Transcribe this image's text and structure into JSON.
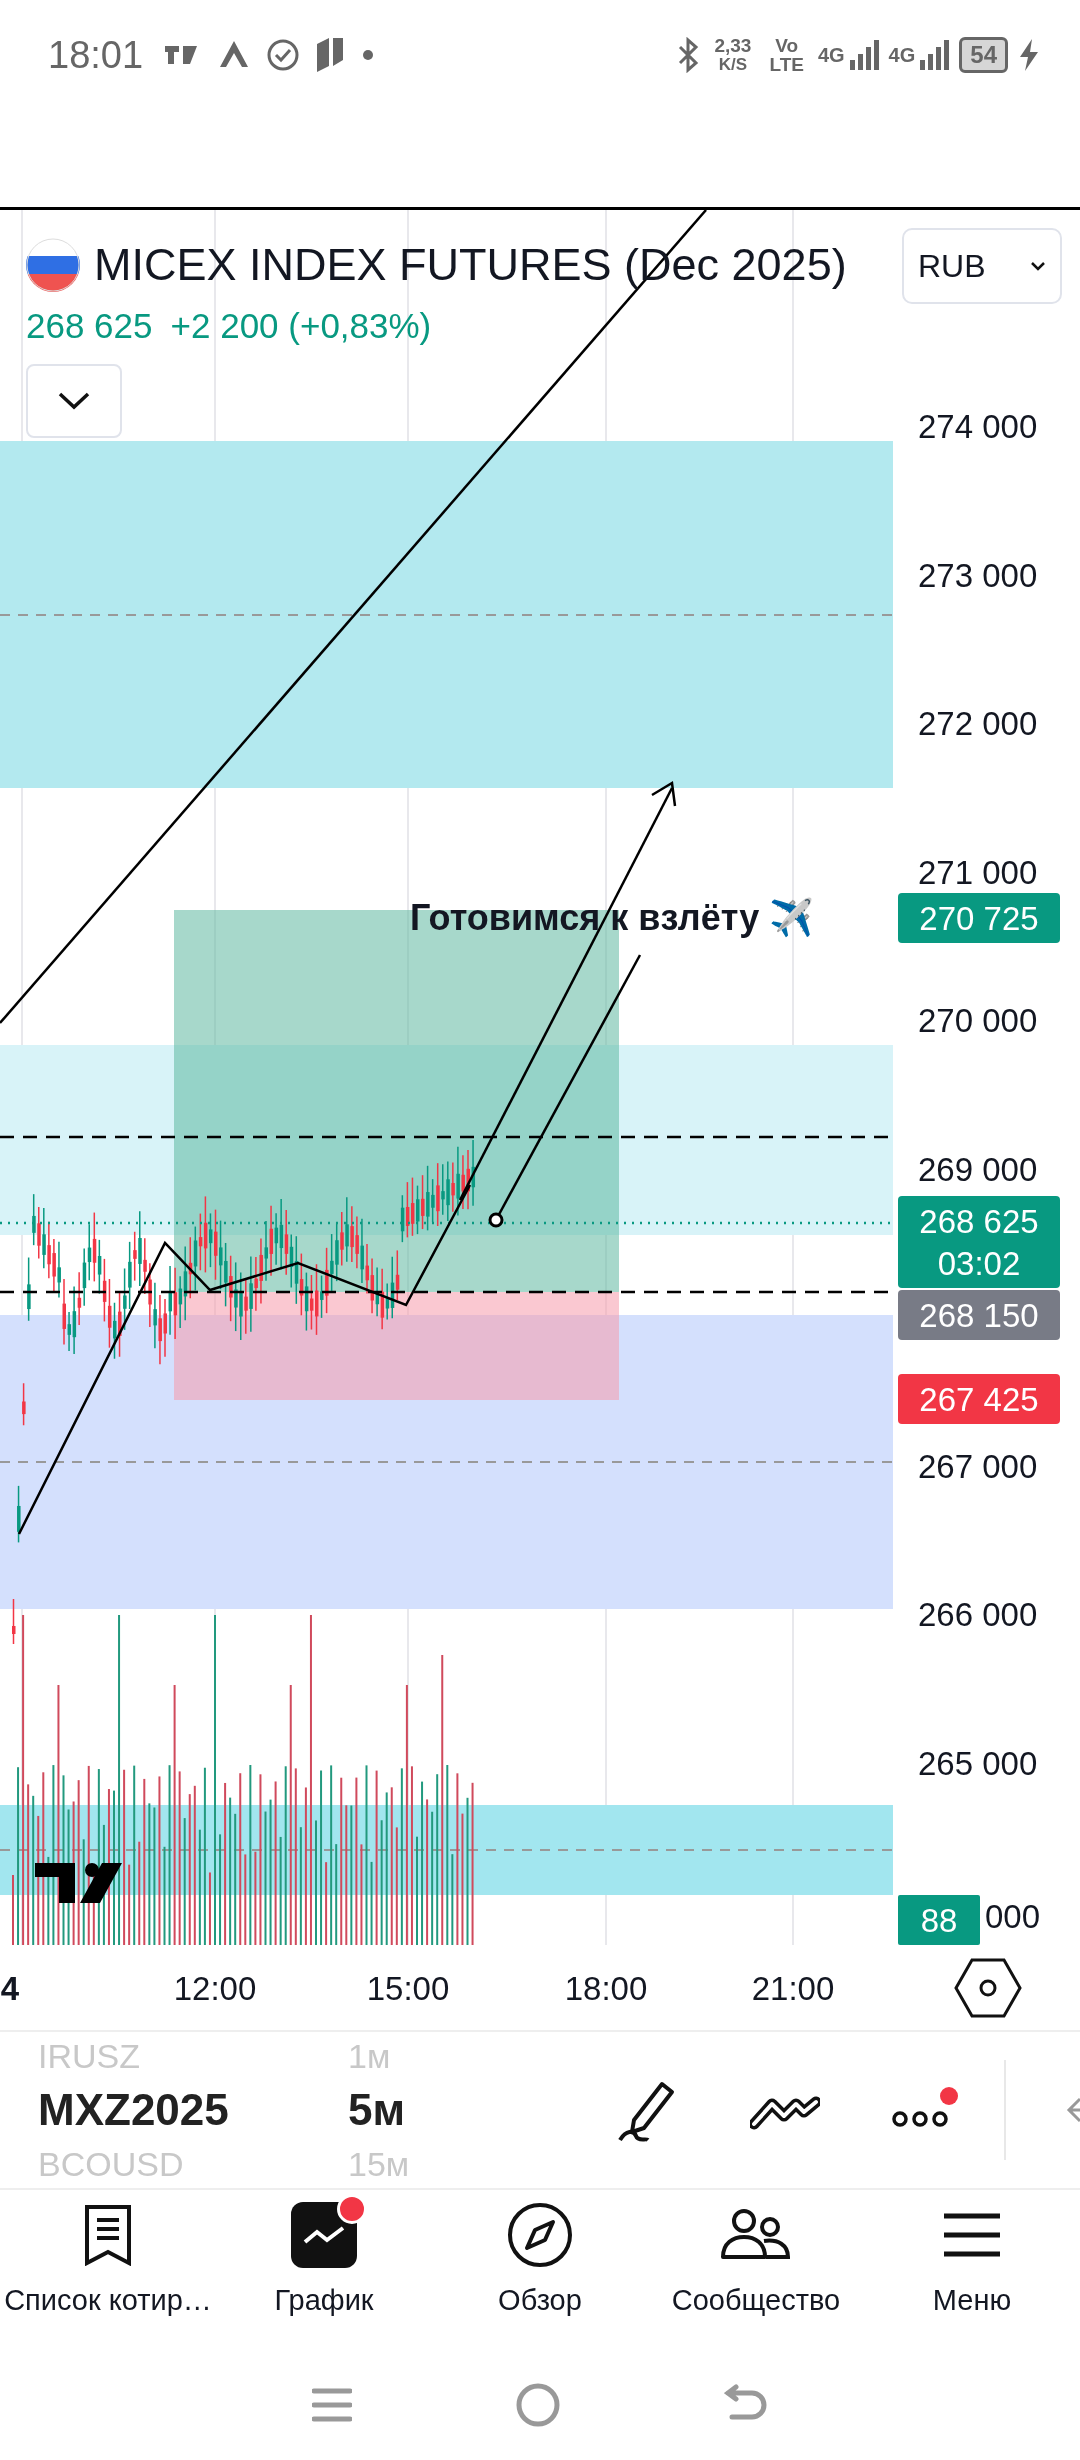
{
  "status_bar": {
    "time": "18:01",
    "speed_value": "2,33",
    "speed_unit": "K/S",
    "volte": [
      "Vo",
      "LTE"
    ],
    "networks": [
      "4G",
      "4G"
    ],
    "battery": "54"
  },
  "header": {
    "title": "MICEX INDEX FUTURES (Dec 2025)",
    "price": "268 625",
    "change": "+2 200 (+0,83%)",
    "currency": "RUB"
  },
  "chart": {
    "price_axis": [
      "274 000",
      "273 000",
      "272 000",
      "271 000",
      "270 000",
      "269 000",
      "267 000",
      "266 000",
      "265 000",
      "000"
    ],
    "time_axis": [
      "4",
      "12:00",
      "15:00",
      "18:00",
      "21:00"
    ],
    "price_tags": [
      {
        "lines": [
          "270 725"
        ],
        "color": "#089981"
      },
      {
        "lines": [
          "268 625",
          "03:02"
        ],
        "color": "#089981"
      },
      {
        "lines": [
          "268 150"
        ],
        "color": "#787b86"
      },
      {
        "lines": [
          "267 425"
        ],
        "color": "#f23645"
      }
    ],
    "annotation": "Готовимся к взлёту ✈️",
    "volume_tag": "88"
  },
  "symbols": [
    {
      "symbol": "IRUSZ",
      "interval": "1м",
      "selected": false
    },
    {
      "symbol": "MXZ2025",
      "interval": "5м",
      "selected": true
    },
    {
      "symbol": "BCOUSD",
      "interval": "15м",
      "selected": false
    }
  ],
  "tools": [
    {
      "kind": "draw",
      "notification": false
    },
    {
      "kind": "indicators",
      "notification": false
    },
    {
      "kind": "more",
      "notification": true
    }
  ],
  "nav": [
    {
      "label": "Список котир…",
      "kind": "watchlist",
      "notification": false
    },
    {
      "label": "График",
      "kind": "chart",
      "notification": true
    },
    {
      "label": "Обзор",
      "kind": "explore",
      "notification": false
    },
    {
      "label": "Сообщество",
      "kind": "community",
      "notification": false
    },
    {
      "label": "Меню",
      "kind": "menu",
      "notification": false
    }
  ]
}
